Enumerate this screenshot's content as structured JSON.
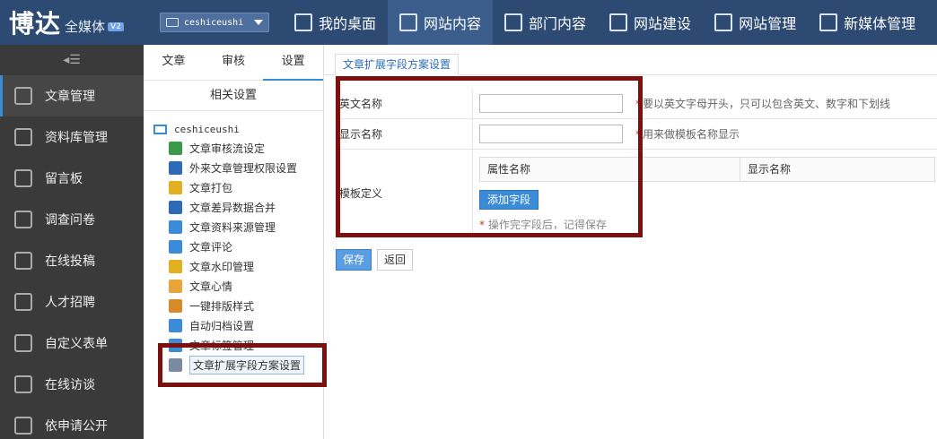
{
  "header": {
    "logo_main": "博达",
    "logo_sub": "全媒体",
    "logo_badge": "V2",
    "site_selector": "ceshiceushi",
    "nav": [
      {
        "label": "我的桌面",
        "active": false
      },
      {
        "label": "网站内容",
        "active": true
      },
      {
        "label": "部门内容",
        "active": false
      },
      {
        "label": "网站建设",
        "active": false
      },
      {
        "label": "网站管理",
        "active": false
      },
      {
        "label": "新媒体管理",
        "active": false
      }
    ]
  },
  "sidebar": {
    "collapse_glyph": "◂☰",
    "items": [
      {
        "label": "文章管理",
        "active": true
      },
      {
        "label": "资料库管理",
        "active": false
      },
      {
        "label": "留言板",
        "active": false
      },
      {
        "label": "调查问卷",
        "active": false
      },
      {
        "label": "在线投稿",
        "active": false
      },
      {
        "label": "人才招聘",
        "active": false
      },
      {
        "label": "自定义表单",
        "active": false
      },
      {
        "label": "在线访谈",
        "active": false
      },
      {
        "label": "依申请公开",
        "active": false
      }
    ]
  },
  "midcol": {
    "tabs": [
      {
        "label": "文章",
        "active": false
      },
      {
        "label": "审核",
        "active": false
      },
      {
        "label": "设置",
        "active": true
      }
    ],
    "section_title": "相关设置",
    "tree_root": "ceshiceushi",
    "tree_items": [
      {
        "label": "文章审核流设定",
        "color": "#3a9a4a"
      },
      {
        "label": "外来文章管理权限设置",
        "color": "#2d6cb5"
      },
      {
        "label": "文章打包",
        "color": "#e0b020"
      },
      {
        "label": "文章差异数据合并",
        "color": "#2d6cb5"
      },
      {
        "label": "文章资料来源管理",
        "color": "#3b8bd6"
      },
      {
        "label": "文章评论",
        "color": "#3b8bd6"
      },
      {
        "label": "文章水印管理",
        "color": "#e0b020"
      },
      {
        "label": "文章心情",
        "color": "#e8a53a"
      },
      {
        "label": "一键排版样式",
        "color": "#d68a2a"
      },
      {
        "label": "自动归档设置",
        "color": "#3b8bd6"
      },
      {
        "label": "文章标签管理",
        "color": "#3b8bd6"
      },
      {
        "label": "文章扩展字段方案设置",
        "color": "#7a8aa0",
        "selected": true
      }
    ]
  },
  "content": {
    "tab_label": "文章扩展字段方案设置",
    "form": {
      "english_name_label": "英文名称",
      "english_name_value": "",
      "english_name_hint": "要以英文字母开头，只可以包含英文、数字和下划线",
      "display_name_label": "显示名称",
      "display_name_value": "",
      "display_name_hint": "用来做模板名称显示",
      "template_label": "模板定义",
      "col_attr_name": "属性名称",
      "col_display_name": "显示名称",
      "add_field_button": "添加字段",
      "save_hint": "操作完字段后，记得保存"
    },
    "save_button": "保存",
    "back_button": "返回"
  },
  "colors": {
    "topbar": "#2d4a73",
    "sidebar": "#3a3a3a",
    "accent": "#3b8bd6",
    "highlight_box": "#7d0f0f"
  }
}
